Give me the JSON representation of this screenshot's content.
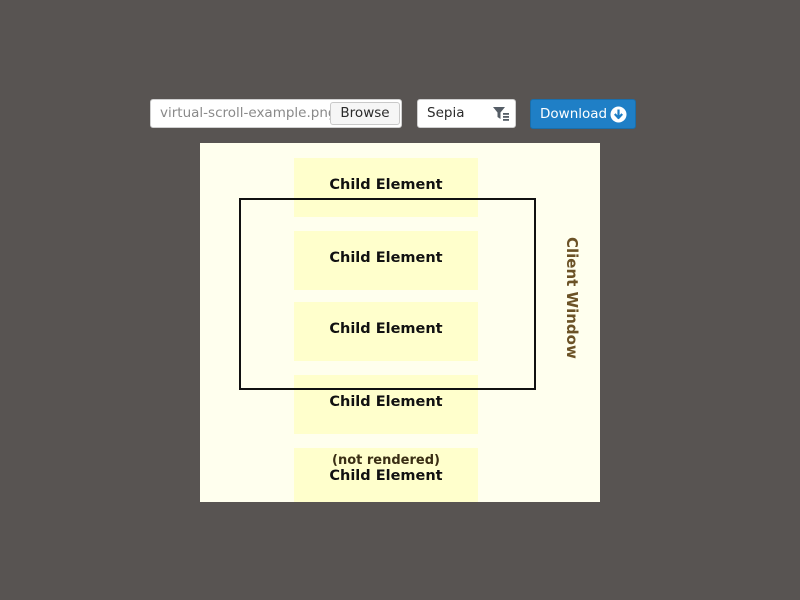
{
  "toolbar": {
    "file_name": "virtual-scroll-example.png",
    "browse_label": "Browse",
    "filter_value": "Sepia",
    "filter_icon": "filter-icon",
    "download_label": "Download",
    "download_icon": "download-circle-icon",
    "accent_color": "#1f7fc6"
  },
  "diagram": {
    "children": [
      {
        "label": "Child Element",
        "note": ""
      },
      {
        "label": "Child Element",
        "note": ""
      },
      {
        "label": "Child Element",
        "note": ""
      },
      {
        "label": "Child Element",
        "note": ""
      },
      {
        "label": "Child Element",
        "note": "(not rendered)"
      }
    ],
    "client_window_label": "Client Window",
    "colors": {
      "background": "#ffffee",
      "child_fill": "#ffffcc",
      "label_color": "#6b5226"
    }
  }
}
